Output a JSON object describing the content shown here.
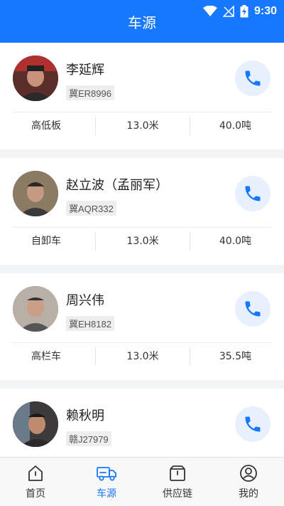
{
  "status": {
    "time": "9:30"
  },
  "header": {
    "title": "车源"
  },
  "vehicles": [
    {
      "name": "李延辉",
      "plate": "冀ER8996",
      "type": "高低板",
      "length": "13.0米",
      "weight": "40.0吨",
      "avatar_color": "#6d4a40"
    },
    {
      "name": "赵立波（孟丽军）",
      "plate": "冀AQR332",
      "type": "自卸车",
      "length": "13.0米",
      "weight": "40.0吨",
      "avatar_color": "#7a6a58"
    },
    {
      "name": "周兴伟",
      "plate": "冀EH8182",
      "type": "高栏车",
      "length": "13.0米",
      "weight": "35.5吨",
      "avatar_color": "#8a7d70"
    },
    {
      "name": "赖秋明",
      "plate": "赣J27979",
      "type": "",
      "length": "",
      "weight": "",
      "avatar_color": "#4d4a48"
    }
  ],
  "tabs": [
    {
      "label": "首页",
      "icon": "home-icon",
      "active": false
    },
    {
      "label": "车源",
      "icon": "truck-icon",
      "active": true
    },
    {
      "label": "供应链",
      "icon": "box-icon",
      "active": false
    },
    {
      "label": "我的",
      "icon": "user-icon",
      "active": false
    }
  ],
  "colors": {
    "primary": "#1677ff",
    "call_bg": "#e8f0fd"
  }
}
